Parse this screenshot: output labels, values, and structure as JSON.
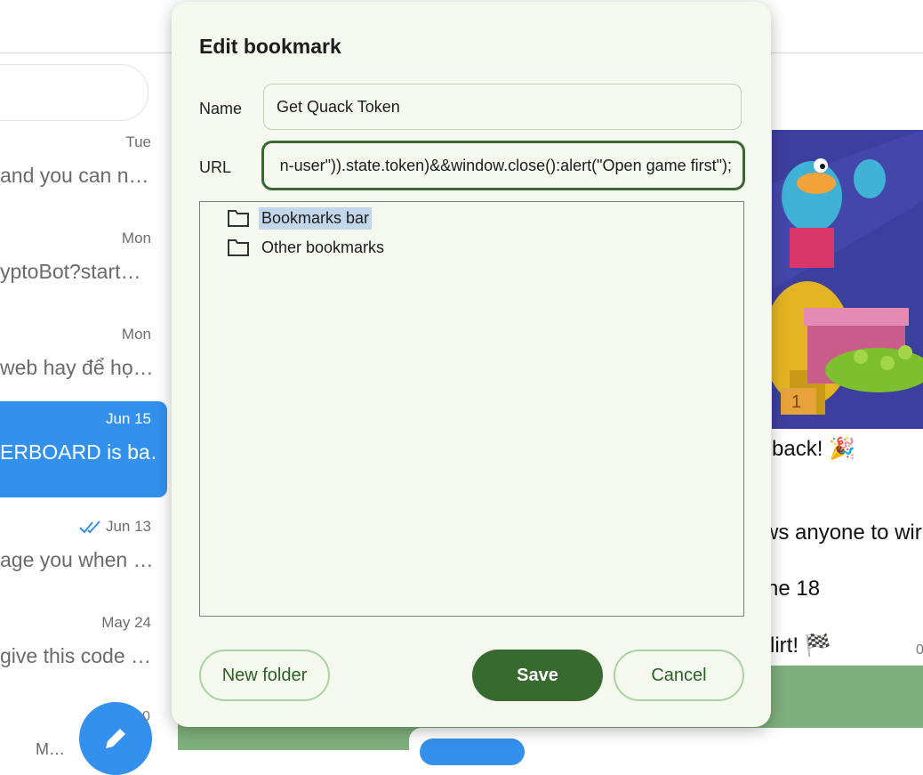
{
  "background": {
    "chat_list": [
      {
        "date": "Tue",
        "preview": "and you can n…",
        "active": false,
        "read_check": false
      },
      {
        "date": "Mon",
        "preview": "yptoBot?start…",
        "active": false,
        "read_check": false
      },
      {
        "date": "Mon",
        "preview": "web hay để họ…",
        "active": false,
        "read_check": false
      },
      {
        "date": "Jun 15",
        "preview": "ERBOARD is ba…",
        "active": true,
        "read_check": false
      },
      {
        "date": "Jun 13",
        "preview": "age you when …",
        "active": false,
        "read_check": true
      },
      {
        "date": "May 24",
        "preview": "give this code …",
        "active": false,
        "read_check": false
      }
    ],
    "fab_badge": "0",
    "cut_text": "M…",
    "messages": [
      "back! 🎉",
      "ws anyone to wir",
      "ne 18",
      "lirt! 🏁"
    ],
    "stray": "0"
  },
  "dialog": {
    "title": "Edit bookmark",
    "name_label": "Name",
    "name_value": "Get Quack Token",
    "url_label": "URL",
    "url_value": "n-user\")).state.token)&&window.close():alert(\"Open game first\");",
    "folders": [
      {
        "label": "Bookmarks bar",
        "selected": true
      },
      {
        "label": "Other bookmarks",
        "selected": false
      }
    ],
    "buttons": {
      "new_folder": "New folder",
      "save": "Save",
      "cancel": "Cancel"
    }
  },
  "colors": {
    "telegram_blue": "#3390ec",
    "dialog_bg": "#f4f8ee",
    "save_green": "#386a2f",
    "url_border": "#3a6731",
    "selection": "#c3d7ea"
  }
}
